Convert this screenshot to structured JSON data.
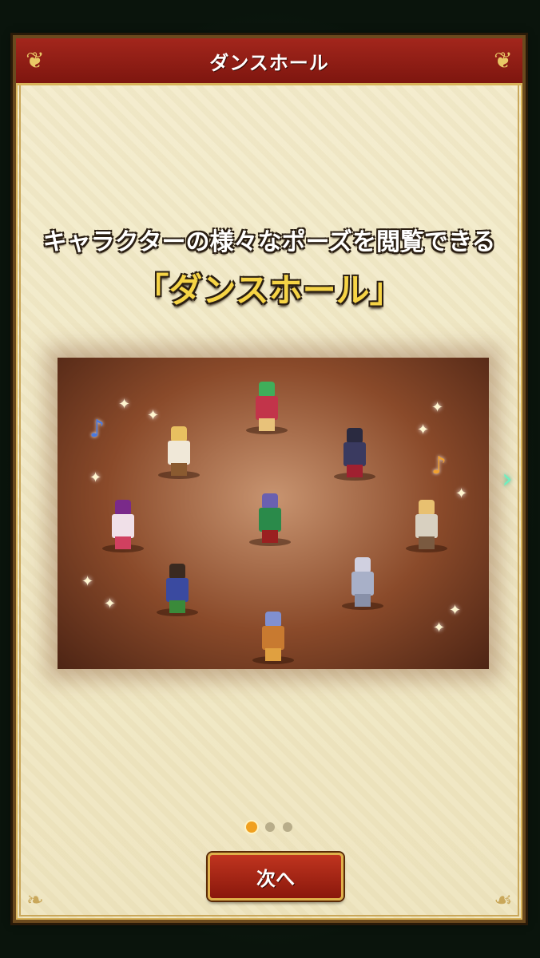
{
  "dialog": {
    "title": "ダンスホール"
  },
  "content": {
    "headline": "キャラクターの様々なポーズを閲覧できる",
    "feature_name": "「ダンスホール」"
  },
  "icons": {
    "corner": "ornament-icon",
    "next_page": "chevron-right-icon",
    "note_blue": "music-note-icon",
    "note_orange": "music-note-icon",
    "sparkle": "sparkle-icon"
  },
  "pagination": {
    "total": 3,
    "current": 1
  },
  "buttons": {
    "next_label": "次へ"
  },
  "colors": {
    "title_bar": "#a3261c",
    "accent_gold": "#f6d445",
    "button": "#c0341f",
    "active_dot": "#f0a020"
  }
}
